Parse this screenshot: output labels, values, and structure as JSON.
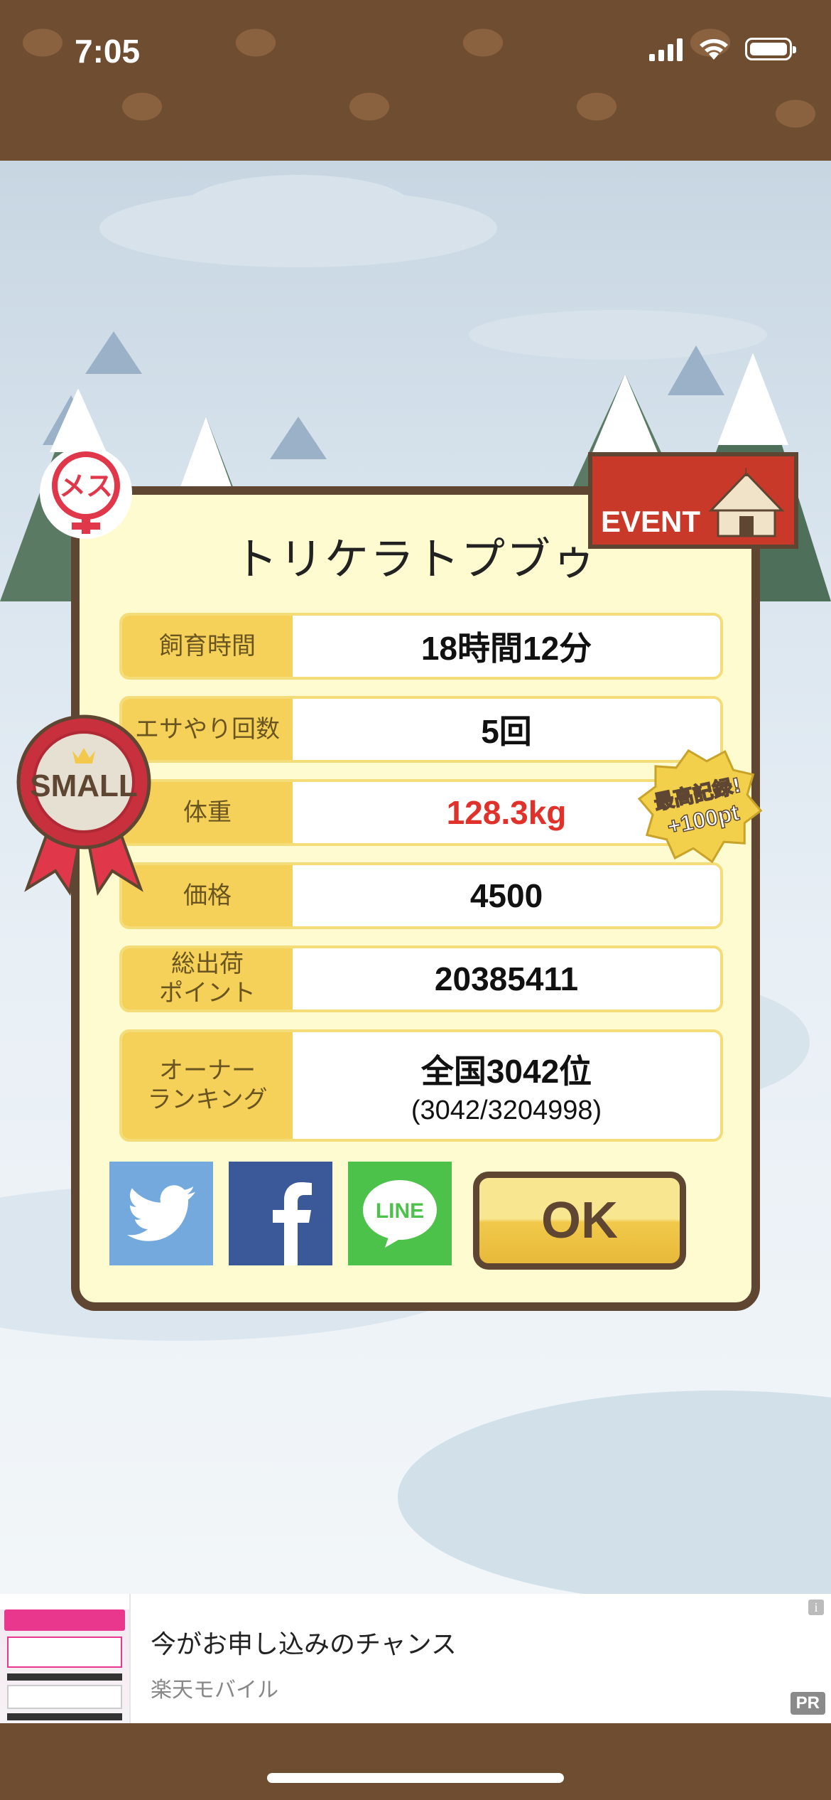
{
  "status_bar": {
    "time": "7:05"
  },
  "dialog": {
    "title": "トリケラトプブゥ",
    "gender_badge": "メス",
    "event_badge": "EVENT",
    "small_badge": "SMALL",
    "record_badge": {
      "line1": "最高記録!",
      "line2": "+100pt"
    },
    "rows": [
      {
        "label": "飼育時間",
        "value": "18時間12分"
      },
      {
        "label": "エサやり回数",
        "value": "5回"
      },
      {
        "label": "体重",
        "value": "128.3kg",
        "highlight_color": "#e0312a"
      },
      {
        "label": "価格",
        "value": "4500"
      },
      {
        "label": "総出荷\nポイント",
        "value": "20385411"
      },
      {
        "label": "オーナー\nランキング",
        "value": "全国3042位",
        "sub": "(3042/3204998)"
      }
    ],
    "share_buttons": {
      "twitter_icon": "twitter-bird",
      "facebook_icon": "f",
      "line_icon": "LINE"
    },
    "ok_label": "OK"
  },
  "ad": {
    "title": "今がお申し込みのチャンス",
    "advertiser": "楽天モバイル",
    "pr_label": "PR",
    "info_label": "i"
  },
  "colors": {
    "frame_brown": "#5e4632",
    "label_yellow": "#f6d15a",
    "panel_cream": "#fffbd0",
    "twitter": "#74a9dd",
    "facebook": "#3b5998",
    "line": "#4cc24a"
  }
}
